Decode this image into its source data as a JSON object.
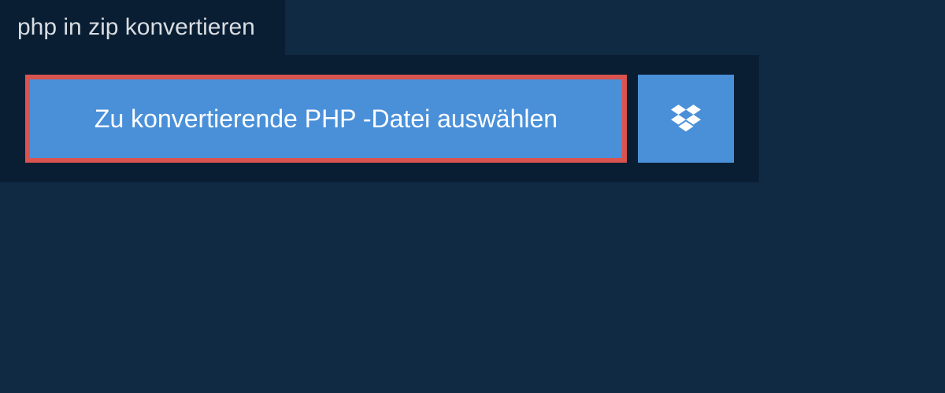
{
  "header": {
    "tab_label": "php in zip konvertieren"
  },
  "main": {
    "select_button_label": "Zu konvertierende PHP -Datei auswählen"
  }
}
